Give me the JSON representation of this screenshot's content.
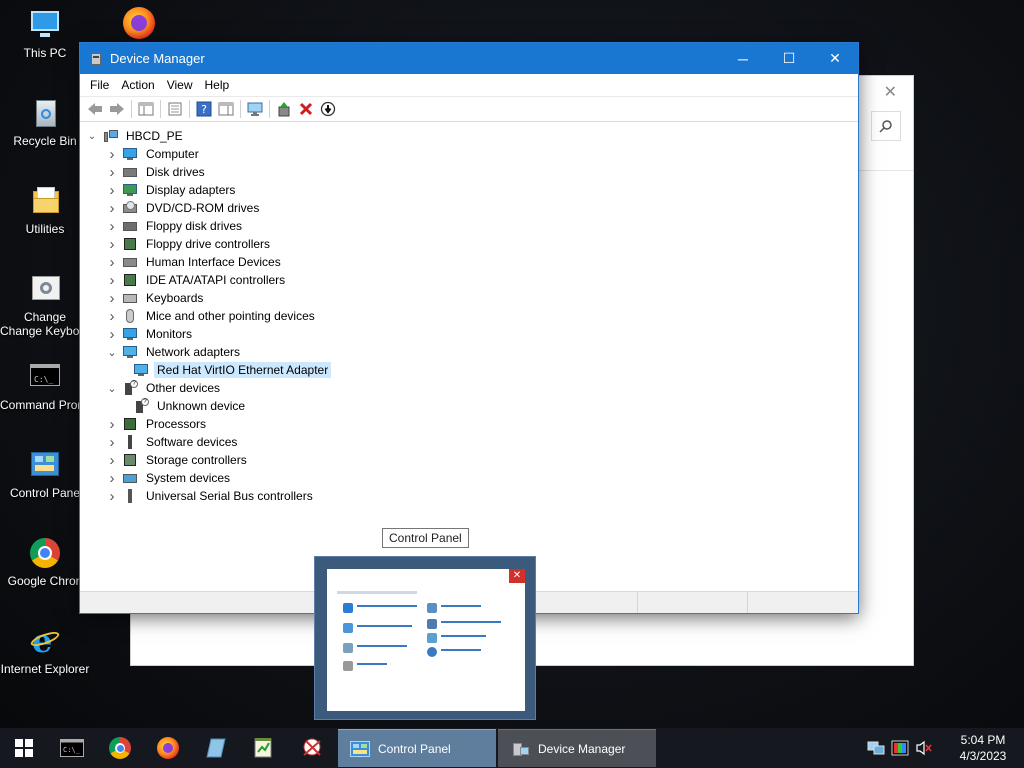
{
  "desktop": {
    "icons": [
      {
        "label": "This PC"
      },
      {
        "label": ""
      },
      {
        "label": "Recycle Bin"
      },
      {
        "label": "Utilities"
      },
      {
        "label": "Change Keyboard Layo"
      },
      {
        "label": "Command Prompt"
      },
      {
        "label": "Control Pane"
      },
      {
        "label": "Google Chron"
      },
      {
        "label": "Internet Explorer"
      }
    ]
  },
  "device_manager": {
    "title": "Device Manager",
    "controls": {
      "minimize": "─",
      "maximize": "☐",
      "close": "✕"
    },
    "menu": [
      "File",
      "Action",
      "View",
      "Help"
    ],
    "tree": {
      "root": "HBCD_PE",
      "items": [
        {
          "label": "Computer",
          "icon": "computer-icon"
        },
        {
          "label": "Disk drives",
          "icon": "disk-drive-icon"
        },
        {
          "label": "Display adapters",
          "icon": "display-adapter-icon"
        },
        {
          "label": "DVD/CD-ROM drives",
          "icon": "dvd-drive-icon"
        },
        {
          "label": "Floppy disk drives",
          "icon": "floppy-disk-icon"
        },
        {
          "label": "Floppy drive controllers",
          "icon": "floppy-controller-icon"
        },
        {
          "label": "Human Interface Devices",
          "icon": "hid-icon"
        },
        {
          "label": "IDE ATA/ATAPI controllers",
          "icon": "ide-controller-icon"
        },
        {
          "label": "Keyboards",
          "icon": "keyboard-icon"
        },
        {
          "label": "Mice and other pointing devices",
          "icon": "mouse-icon"
        },
        {
          "label": "Monitors",
          "icon": "monitor-icon"
        },
        {
          "label": "Network adapters",
          "icon": "network-adapter-icon",
          "expanded": true
        },
        {
          "label": "Red Hat VirtIO Ethernet Adapter",
          "icon": "network-adapter-icon",
          "child": true,
          "selected": true
        },
        {
          "label": "Other devices",
          "icon": "unknown-device-icon",
          "expanded": true
        },
        {
          "label": "Unknown device",
          "icon": "unknown-device-icon",
          "child": true
        },
        {
          "label": "Processors",
          "icon": "processor-icon"
        },
        {
          "label": "Software devices",
          "icon": "software-device-icon"
        },
        {
          "label": "Storage controllers",
          "icon": "storage-controller-icon"
        },
        {
          "label": "System devices",
          "icon": "system-device-icon"
        },
        {
          "label": "Universal Serial Bus controllers",
          "icon": "usb-icon"
        }
      ]
    }
  },
  "tooltip": {
    "text": "Control Panel"
  },
  "taskbar": {
    "tasks": [
      {
        "label": "Control Panel"
      },
      {
        "label": "Device Manager"
      }
    ],
    "clock": {
      "time": "5:04 PM",
      "date": "4/3/2023"
    }
  },
  "colors": {
    "titlebar": "#1a77d1",
    "selection": "#cce8ff",
    "taskbar": "#15191f",
    "active_task": "#5f7e9e"
  }
}
